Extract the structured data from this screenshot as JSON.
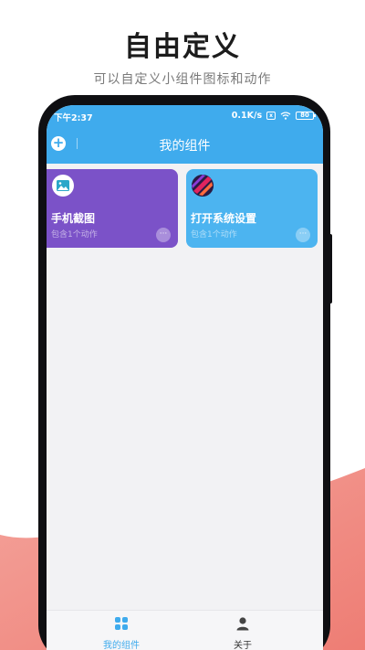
{
  "promo": {
    "title": "自由定义",
    "subtitle": "可以自定义小组件图标和动作"
  },
  "status_bar": {
    "time": "下午2:37",
    "speed": "0.1K/s",
    "sim_icon": "x",
    "battery": "80"
  },
  "app_bar": {
    "title": "我的组件",
    "add_icon": "+"
  },
  "widgets": [
    {
      "title": "手机截图",
      "subtitle": "包含1个动作",
      "icon": "screenshot-image-icon",
      "color": "#7b52c8",
      "more": "···"
    },
    {
      "title": "打开系统设置",
      "subtitle": "包含1个动作",
      "icon": "system-settings-icon",
      "color": "#4cb4f0",
      "more": "···"
    }
  ],
  "bottom_nav": {
    "home_label": "我的组件",
    "about_label": "关于",
    "active_color": "#3fabed"
  },
  "colors": {
    "accent": "#3fabed",
    "wave": "#f28b82"
  }
}
